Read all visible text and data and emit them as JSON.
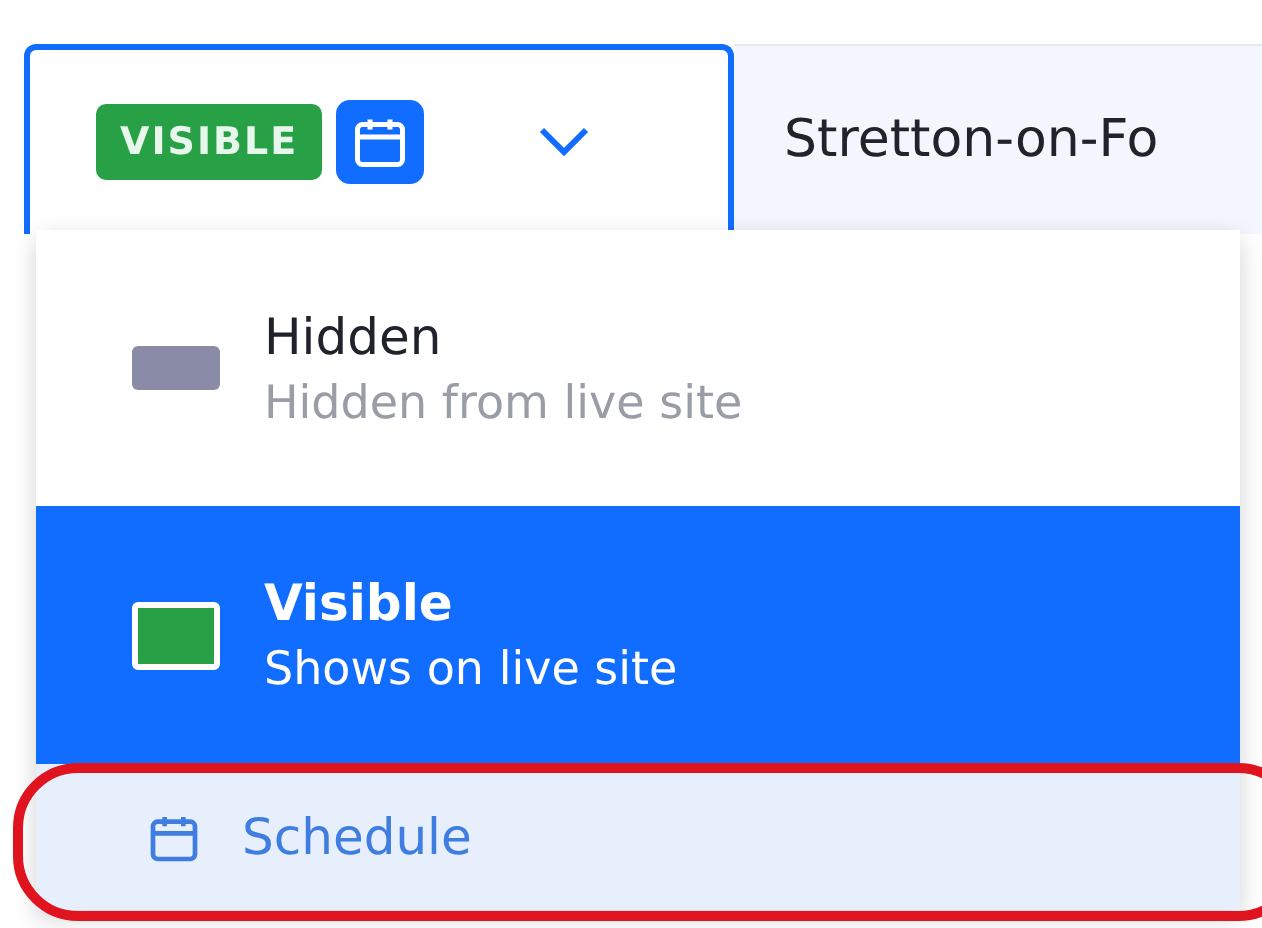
{
  "status_cell": {
    "badge": "VISIBLE",
    "scheduled": true
  },
  "name_cell": {
    "text": "Stretton-on-Fo"
  },
  "menu": {
    "items": [
      {
        "title": "Hidden",
        "subtitle": "Hidden from live site",
        "color": "#8a8ba6",
        "selected": false
      },
      {
        "title": "Visible",
        "subtitle": "Shows on live site",
        "color": "#27a046",
        "selected": true
      }
    ],
    "action": {
      "label": "Schedule"
    }
  }
}
